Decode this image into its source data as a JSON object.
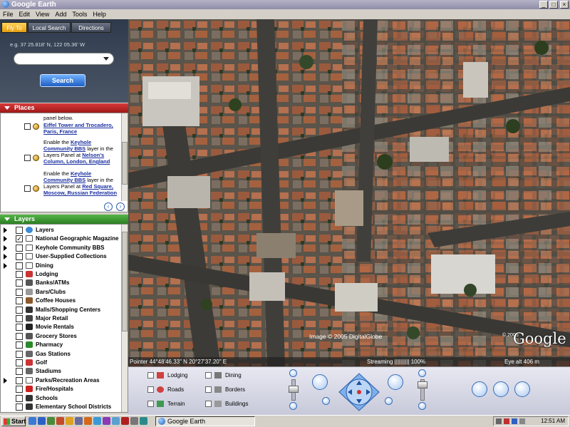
{
  "window": {
    "title": "Google Earth",
    "buttons": [
      "_",
      "□",
      "×"
    ]
  },
  "menu": [
    "File",
    "Edit",
    "View",
    "Add",
    "Tools",
    "Help"
  ],
  "search": {
    "tabs": [
      "Fly To",
      "Local Search",
      "Directions"
    ],
    "active_tab": "Fly To",
    "example": "e.g. 37 25.818' N, 122 05.36' W",
    "input_value": "",
    "button": "Search"
  },
  "places": {
    "header": "Places",
    "intro": "panel below.",
    "items": [
      {
        "link": "Eiffel Tower and Trocadero, Paris, France"
      },
      {
        "pre": "Enable the ",
        "layer": "Keyhole Community BBS",
        "mid": " layer in the Layers Panel at ",
        "link": "Nelson's Column, London, England"
      },
      {
        "pre": "Enable the ",
        "layer": "Keyhole Community BBS",
        "mid": " layer in the Layers Panel at ",
        "link": "Red Square, Moscow, Russian Federation"
      }
    ]
  },
  "layers": {
    "header": "Layers",
    "items": [
      {
        "label": "Layers",
        "expander": true,
        "checked": false,
        "icon": "globe"
      },
      {
        "label": "National Geographic Magazine",
        "expander": true,
        "checked": true,
        "icon": "folder"
      },
      {
        "label": "Keyhole Community BBS",
        "expander": true,
        "checked": false,
        "icon": "folder"
      },
      {
        "label": "User-Supplied Collections",
        "expander": true,
        "checked": false,
        "icon": "folder"
      },
      {
        "label": "Dining",
        "expander": true,
        "checked": false,
        "icon": "folder"
      },
      {
        "label": "Lodging",
        "expander": false,
        "checked": false,
        "icon": "bed"
      },
      {
        "label": "Banks/ATMs",
        "expander": false,
        "checked": false,
        "icon": "bank"
      },
      {
        "label": "Bars/Clubs",
        "expander": false,
        "checked": false,
        "icon": "glass"
      },
      {
        "label": "Coffee Houses",
        "expander": false,
        "checked": false,
        "icon": "cup"
      },
      {
        "label": "Malls/Shopping Centers",
        "expander": false,
        "checked": false,
        "icon": "mall"
      },
      {
        "label": "Major Retail",
        "expander": false,
        "checked": false,
        "icon": "retail"
      },
      {
        "label": "Movie Rentals",
        "expander": false,
        "checked": false,
        "icon": "film"
      },
      {
        "label": "Grocery Stores",
        "expander": false,
        "checked": false,
        "icon": "cart"
      },
      {
        "label": "Pharmacy",
        "expander": false,
        "checked": false,
        "icon": "pharmacy"
      },
      {
        "label": "Gas Stations",
        "expander": false,
        "checked": false,
        "icon": "gas"
      },
      {
        "label": "Golf",
        "expander": false,
        "checked": false,
        "icon": "flag"
      },
      {
        "label": "Stadiums",
        "expander": false,
        "checked": false,
        "icon": "stadium"
      },
      {
        "label": "Parks/Recreation Areas",
        "expander": true,
        "checked": false,
        "icon": "folder"
      },
      {
        "label": "Fire/Hospitals",
        "expander": false,
        "checked": false,
        "icon": "hospital"
      },
      {
        "label": "Schools",
        "expander": false,
        "checked": false,
        "icon": "school"
      },
      {
        "label": "Elementary School Districts",
        "expander": false,
        "checked": false,
        "icon": "school"
      }
    ]
  },
  "map": {
    "copyright": "Image © 2005 DigitalGlobe",
    "logo": "Google",
    "logo_c": "© 2005",
    "pointer": "Pointer 44°48'46.33\" N  20°27'37.20\" E",
    "streaming": "Streaming |||||||||| 100%",
    "eye_alt": "Eye alt   406 m"
  },
  "controls": {
    "layer_toggles": [
      {
        "label": "Lodging",
        "icon": "bed"
      },
      {
        "label": "Roads",
        "icon": "road"
      },
      {
        "label": "Terrain",
        "icon": "terrain"
      },
      {
        "label": "Dining",
        "icon": "fork"
      },
      {
        "label": "Borders",
        "icon": "border"
      },
      {
        "label": "Buildings",
        "icon": "building"
      }
    ]
  },
  "taskbar": {
    "start": "Start",
    "task": "Google Earth",
    "clock": "12:51 AM"
  },
  "colors": {
    "places_header": "#c02020",
    "layers_header": "#3b9a2f",
    "active_tab": "#f0b020",
    "search_button": "#2a72d8"
  }
}
